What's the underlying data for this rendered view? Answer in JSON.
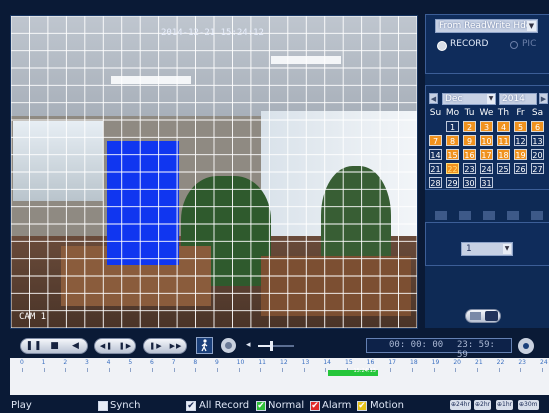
{
  "video": {
    "timestamp": "2014-12-21 15:24:12",
    "channel_label": "CAM 1"
  },
  "source_panel": {
    "source_select": "From ReadWrite Hdd",
    "record_option": "RECORD",
    "pic_option": "PIC",
    "selected_option": "RECORD"
  },
  "calendar": {
    "month": "Dec",
    "year": "2014",
    "prev_icon": "chevron-left-icon",
    "next_icon": "chevron-right-icon",
    "weekdays": [
      "Su",
      "Mo",
      "Tu",
      "We",
      "Th",
      "Fr",
      "Sa"
    ],
    "weeks": [
      [
        "",
        "1",
        "2",
        "3",
        "4",
        "5",
        "6"
      ],
      [
        "7",
        "8",
        "9",
        "10",
        "11",
        "12",
        "13"
      ],
      [
        "14",
        "15",
        "16",
        "17",
        "18",
        "19",
        "20"
      ],
      [
        "21",
        "22",
        "23",
        "24",
        "25",
        "26",
        "27"
      ],
      [
        "28",
        "29",
        "30",
        "31",
        "",
        "",
        ""
      ]
    ],
    "recorded_days": [
      "2",
      "3",
      "4",
      "5",
      "6",
      "7",
      "8",
      "9",
      "10",
      "11",
      "15",
      "16",
      "17",
      "18",
      "19",
      "22"
    ],
    "selected_day": "22"
  },
  "window_split": {
    "icons": [
      "single-window-icon",
      "quad-window-icon",
      "nine-window-icon",
      "sixteen-window-icon",
      "fullscreen-icon"
    ]
  },
  "channel_select": {
    "value": "1"
  },
  "view_toggle": {
    "icons": [
      "search-list-icon",
      "file-list-icon"
    ]
  },
  "controls": {
    "play_pause_label": "❚❚",
    "stop_label": "■",
    "reverse_label": "◀",
    "slow_back_label": "◀❚",
    "slow_forward_label": "❚▶",
    "step_forward_label": "❚▶",
    "fast_forward_label": "▶▶",
    "smart_search_icon": "person-walking-icon",
    "snapshot_icon": "camera-icon",
    "volume_icon": "speaker-icon",
    "volume_level": 0.35,
    "clip_icon": "film-clip-icon",
    "time_start": "00: 00: 00",
    "time_end": "23: 59: 59",
    "backup_icon": "backup-disc-icon"
  },
  "timeline": {
    "hour_labels": [
      "0",
      "1",
      "2",
      "3",
      "4",
      "5",
      "6",
      "7",
      "8",
      "9",
      "10",
      "11",
      "12",
      "13",
      "14",
      "15",
      "16",
      "17",
      "18",
      "19",
      "20",
      "21",
      "22",
      "23",
      "24"
    ],
    "record_start_hour": 14.1,
    "record_end_hour": 16.45,
    "cursor_label": "15:24:13",
    "record_color": "#25c63a"
  },
  "bottom_bar": {
    "mode_label": "Play",
    "synch_label": "Synch",
    "synch_checked": false,
    "all_record_label": "All Record",
    "normal_label": "Normal",
    "alarm_label": "Alarm",
    "motion_label": "Motion",
    "zoom_labels": [
      "24hr",
      "2hr",
      "1hr",
      "30m"
    ],
    "colors": {
      "normal": "#2fbf3a",
      "alarm": "#e02a2a",
      "motion": "#e5c21a"
    }
  }
}
